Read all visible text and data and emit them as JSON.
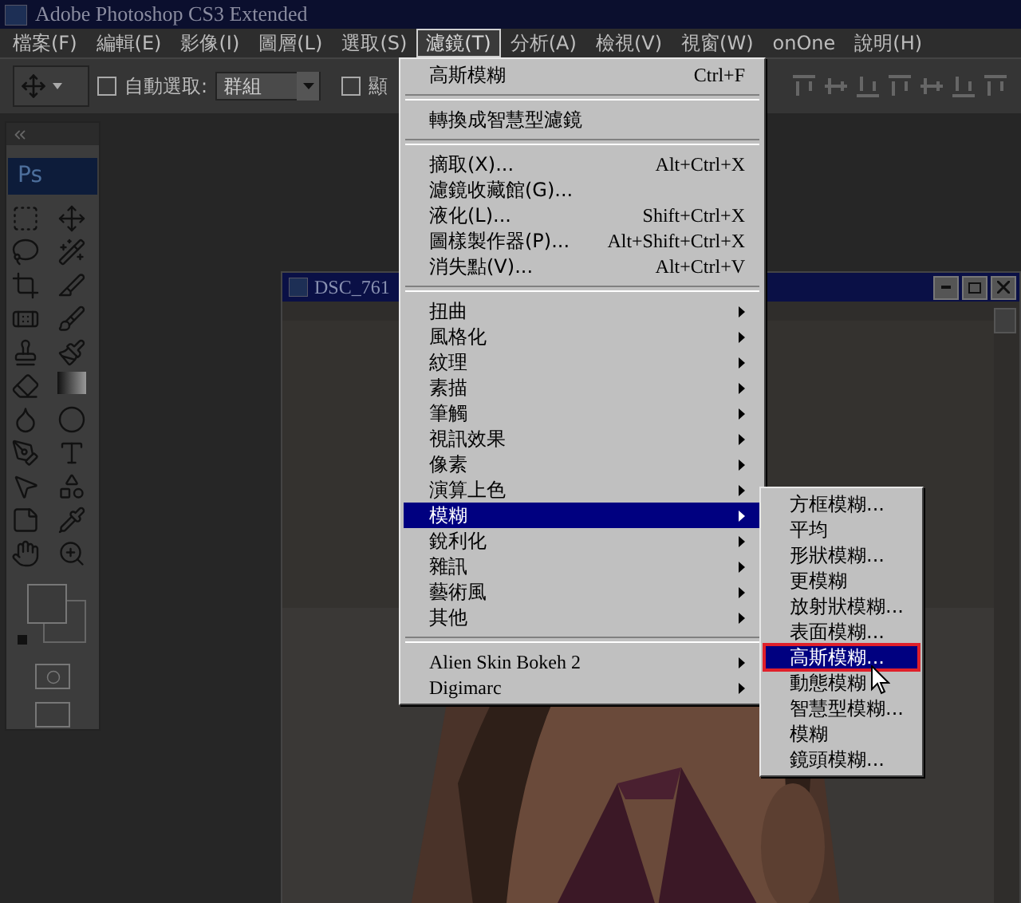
{
  "window": {
    "title": "Adobe Photoshop CS3 Extended"
  },
  "menu_bar": [
    {
      "label": "檔案(F)",
      "selected": false
    },
    {
      "label": "編輯(E)",
      "selected": false
    },
    {
      "label": "影像(I)",
      "selected": false
    },
    {
      "label": "圖層(L)",
      "selected": false
    },
    {
      "label": "選取(S)",
      "selected": false
    },
    {
      "label": "濾鏡(T)",
      "selected": true
    },
    {
      "label": "分析(A)",
      "selected": false
    },
    {
      "label": "檢視(V)",
      "selected": false
    },
    {
      "label": "視窗(W)",
      "selected": false
    },
    {
      "label": "onOne",
      "selected": false
    },
    {
      "label": "說明(H)",
      "selected": false
    }
  ],
  "options_bar": {
    "auto_select": {
      "label": "自動選取:",
      "checked": false
    },
    "auto_select_mode": "群組",
    "show_transform": {
      "label": "顯",
      "checked": false
    }
  },
  "toolbox": {
    "logo": "Ps"
  },
  "document": {
    "title": "DSC_761"
  },
  "filter_menu": {
    "groups": [
      [
        {
          "label": "高斯模糊",
          "shortcut": "Ctrl+F",
          "has_submenu": false,
          "selected": false
        }
      ],
      [
        {
          "label": "轉換成智慧型濾鏡",
          "has_submenu": false,
          "selected": false
        }
      ],
      [
        {
          "label": "摘取(X)...",
          "shortcut": "Alt+Ctrl+X",
          "has_submenu": false,
          "selected": false
        },
        {
          "label": "濾鏡收藏館(G)...",
          "has_submenu": false,
          "selected": false
        },
        {
          "label": "液化(L)...",
          "shortcut": "Shift+Ctrl+X",
          "has_submenu": false,
          "selected": false
        },
        {
          "label": "圖樣製作器(P)...",
          "shortcut": "Alt+Shift+Ctrl+X",
          "has_submenu": false,
          "selected": false
        },
        {
          "label": "消失點(V)...",
          "shortcut": "Alt+Ctrl+V",
          "has_submenu": false,
          "selected": false
        }
      ],
      [
        {
          "label": "扭曲",
          "has_submenu": true,
          "selected": false
        },
        {
          "label": "風格化",
          "has_submenu": true,
          "selected": false
        },
        {
          "label": "紋理",
          "has_submenu": true,
          "selected": false
        },
        {
          "label": "素描",
          "has_submenu": true,
          "selected": false
        },
        {
          "label": "筆觸",
          "has_submenu": true,
          "selected": false
        },
        {
          "label": "視訊效果",
          "has_submenu": true,
          "selected": false
        },
        {
          "label": "像素",
          "has_submenu": true,
          "selected": false
        },
        {
          "label": "演算上色",
          "has_submenu": true,
          "selected": false
        },
        {
          "label": "模糊",
          "has_submenu": true,
          "selected": true
        },
        {
          "label": "銳利化",
          "has_submenu": true,
          "selected": false
        },
        {
          "label": "雜訊",
          "has_submenu": true,
          "selected": false
        },
        {
          "label": "藝術風",
          "has_submenu": true,
          "selected": false
        },
        {
          "label": "其他",
          "has_submenu": true,
          "selected": false
        }
      ],
      [
        {
          "label": "Alien Skin Bokeh 2",
          "has_submenu": true,
          "selected": false
        },
        {
          "label": "Digimarc",
          "has_submenu": true,
          "selected": false
        }
      ]
    ]
  },
  "blur_submenu": {
    "items": [
      {
        "label": "方框模糊...",
        "selected": false
      },
      {
        "label": "平均",
        "selected": false
      },
      {
        "label": "形狀模糊...",
        "selected": false
      },
      {
        "label": "更模糊",
        "selected": false
      },
      {
        "label": "放射狀模糊...",
        "selected": false
      },
      {
        "label": "表面模糊...",
        "selected": false
      },
      {
        "label": "高斯模糊...",
        "selected": true
      },
      {
        "label": "動態模糊",
        "selected": false
      },
      {
        "label": "智慧型模糊...",
        "selected": false
      },
      {
        "label": "模糊",
        "selected": false
      },
      {
        "label": "鏡頭模糊...",
        "selected": false
      }
    ]
  }
}
